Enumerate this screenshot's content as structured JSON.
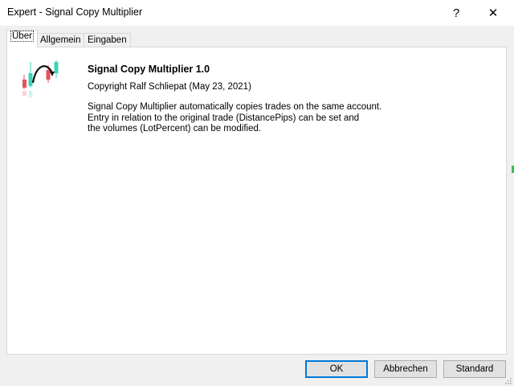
{
  "window": {
    "title": "Expert - Signal Copy Multiplier",
    "help_glyph": "?",
    "close_glyph": "✕"
  },
  "tabs": [
    {
      "label": "Über",
      "active": true
    },
    {
      "label": "Allgemein",
      "active": false
    },
    {
      "label": "Eingaben",
      "active": false
    }
  ],
  "about": {
    "name": "Signal Copy Multiplier 1.0",
    "copyright": "Copyright Ralf Schliepat (May 23, 2021)",
    "description": [
      "Signal Copy Multiplier automatically copies trades on the same account.",
      "Entry in relation to the original trade (DistancePips) can be set and",
      "the volumes (LotPercent) can be modified."
    ]
  },
  "buttons": {
    "ok": "OK",
    "cancel": "Abbrechen",
    "standard": "Standard"
  },
  "icons": {
    "logo": "expert-candles-logo",
    "help": "help-icon",
    "close": "close-icon",
    "grip": "resize-grip-icon"
  },
  "colors": {
    "candle_bear": "#e8505b",
    "candle_bull": "#3fd3b7",
    "default_button_border": "#0078d7"
  }
}
